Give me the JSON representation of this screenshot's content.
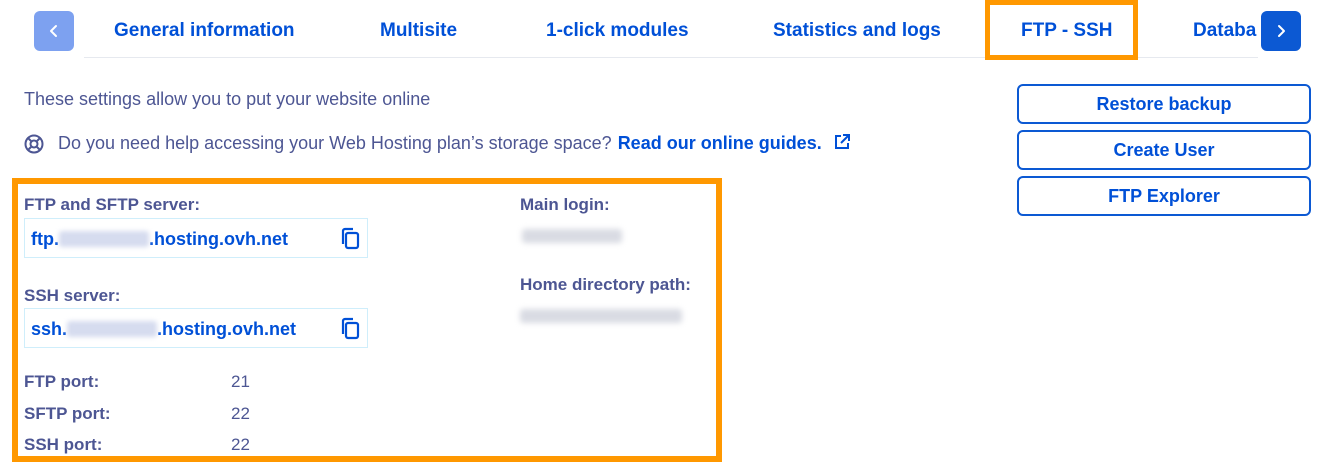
{
  "tabs": [
    {
      "label": "General information"
    },
    {
      "label": "Multisite"
    },
    {
      "label": "1-click modules"
    },
    {
      "label": "Statistics and logs"
    },
    {
      "label": "FTP - SSH"
    },
    {
      "label": "Databa"
    }
  ],
  "active_tab": "FTP - SSH",
  "intro_text": "These settings allow you to put your website online",
  "help": {
    "text": "Do you need help accessing your Web Hosting plan’s storage space?",
    "link_text": "Read our online guides."
  },
  "actions": {
    "restore": "Restore backup",
    "create_user": "Create User",
    "ftp_explorer": "FTP Explorer"
  },
  "ftp": {
    "label": "FTP and SFTP server:",
    "prefix": "ftp.",
    "suffix": ".hosting.ovh.net"
  },
  "ssh": {
    "label": "SSH server:",
    "prefix": "ssh.",
    "suffix": ".hosting.ovh.net"
  },
  "ports": [
    {
      "label": "FTP port:",
      "value": "21"
    },
    {
      "label": "SFTP port:",
      "value": "22"
    },
    {
      "label": "SSH port:",
      "value": "22"
    }
  ],
  "main_login": {
    "label": "Main login:"
  },
  "home_dir": {
    "label": "Home directory path:"
  },
  "colors": {
    "accent": "#0050d7",
    "highlight": "#ff9800",
    "text": "#4d5693"
  },
  "icons": [
    "chevron-left-icon",
    "chevron-right-icon",
    "lifebuoy-icon",
    "external-link-icon",
    "copy-icon"
  ]
}
